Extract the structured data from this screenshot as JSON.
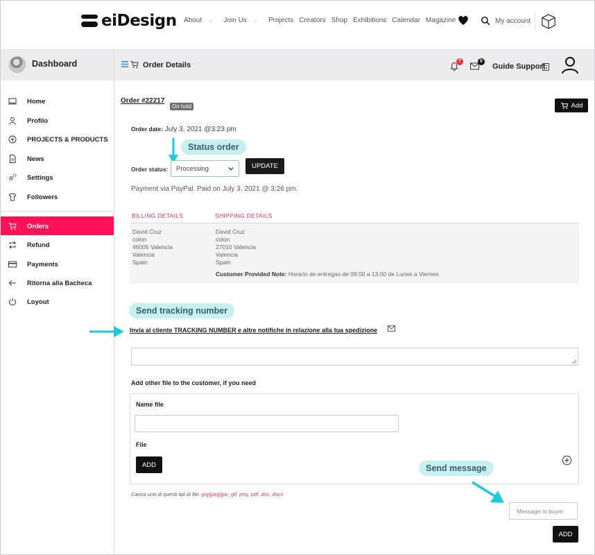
{
  "brand": {
    "name": "eiDesign"
  },
  "nav": {
    "items": [
      {
        "label": "About",
        "dropdown": true
      },
      {
        "label": "Join Us",
        "dropdown": true
      },
      {
        "label": "Projects",
        "dropdown": false
      },
      {
        "label": "Creators",
        "dropdown": false
      },
      {
        "label": "Shop",
        "dropdown": false
      },
      {
        "label": "Exhibitions",
        "dropdown": false
      },
      {
        "label": "Calendar",
        "dropdown": false
      },
      {
        "label": "Magazine",
        "dropdown": false
      }
    ],
    "account_label": "My account",
    "caret": "⌵"
  },
  "subheader": {
    "dashboard_label": "Dashboard",
    "page_title": "Order Details",
    "notifications_count": "7",
    "messages_count": "0",
    "guide_label": "Guide Support."
  },
  "sidebar": {
    "items": [
      {
        "label": "Home",
        "icon": "monitor-icon"
      },
      {
        "label": "Profilo",
        "icon": "user-icon"
      },
      {
        "label": "PROJECTS & PRODUCTS",
        "icon": "plus-circle-icon"
      },
      {
        "label": "News",
        "icon": "document-icon"
      },
      {
        "label": "Settings",
        "icon": "gears-icon"
      },
      {
        "label": "Followers",
        "icon": "shirt-icon"
      }
    ],
    "items2": [
      {
        "label": "Orders",
        "icon": "cart-icon",
        "active": true
      },
      {
        "label": "Refund",
        "icon": "repeat-icon"
      },
      {
        "label": "Payments",
        "icon": "card-icon"
      },
      {
        "label": "Ritorna alla Bacheca",
        "icon": "arrow-left-icon"
      },
      {
        "label": "Loyout",
        "icon": "power-icon"
      }
    ]
  },
  "order": {
    "number": "Order #22217",
    "status_badge": "On hold",
    "add_label": "Add",
    "date_label": "Order date:",
    "date_value": " July 3, 2021 @3:23 pm",
    "status_label": "Order status:",
    "status_value": "Processing",
    "update_label": "UPDATE",
    "payment_text": "Payment via PayPal. Paid on July 3, 2021 @ 3:26 pm."
  },
  "callouts": {
    "status_order": "Status order",
    "send_tracking": "Send tracking number",
    "send_message": "Send message"
  },
  "billing": {
    "heading": "BILLING DETAILS",
    "lines": [
      "David Cruz",
      "colon",
      "46005 Valencia",
      "Valencia",
      "Spain"
    ]
  },
  "shipping": {
    "heading": "SHIPPING DETAILS",
    "lines": [
      "David Cruz",
      "colon",
      "27010 Valencia",
      "Valencia",
      "Spain"
    ],
    "note_label": "Customer Provided Note:",
    "note_value": " Horario de entregas de 09:00 a 13:00 de Lunes a Viernes"
  },
  "tracking": {
    "link_text": "Invia al cliente TRACKING NUMBER e altre notifiche in relazione alla tua spedizione"
  },
  "files": {
    "section_label": "Add other file to the customer, if you need",
    "name_label": "Name file",
    "file_label": "File",
    "add_label": "ADD",
    "hint_prefix": "Carica uno di questi tipi di file: ",
    "hint_types": "jpg|jpeg|jpe, gif, png, pdf, doc, docx"
  },
  "message": {
    "placeholder": "Message to buyer",
    "add_label": "ADD"
  },
  "colors": {
    "accent": "#ff1259",
    "callout_bg": "#c6f0f2",
    "arrow": "#1ec9d8",
    "heading_pink": "#e0336a"
  }
}
